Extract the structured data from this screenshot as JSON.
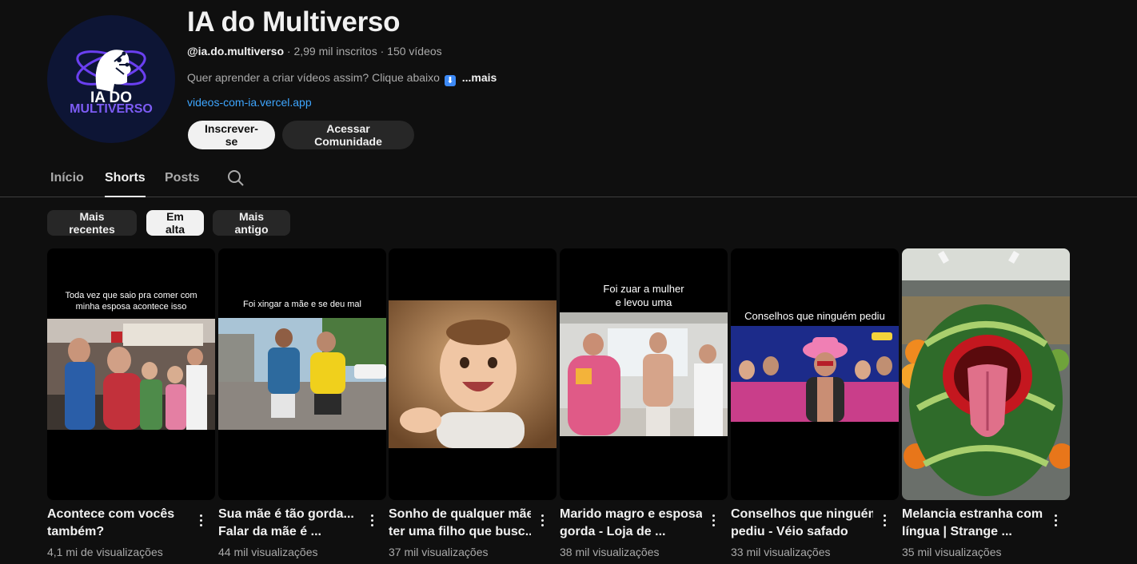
{
  "channel": {
    "logo_line1": "IA DO",
    "logo_line2": "MULTIVERSO",
    "name": "IA do Multiverso",
    "handle": "@ia.do.multiverso",
    "stats": " · 2,99 mil inscritos · 150 vídeos",
    "description": "Quer aprender a criar vídeos assim? Clique abaixo",
    "description_emoji": "⬇",
    "more_label": "...mais",
    "link": "videos-com-ia.vercel.app",
    "subscribe_label": "Inscrever-se",
    "community_label": "Acessar Comunidade"
  },
  "tabs": {
    "home": "Início",
    "shorts": "Shorts",
    "posts": "Posts",
    "active": "shorts"
  },
  "chips": {
    "recent": "Mais recentes",
    "popular": "Em alta",
    "oldest": "Mais antigo",
    "active": "popular"
  },
  "shorts": [
    {
      "caption": "Toda vez que saio pra comer com minha esposa acontece isso",
      "title_line1": "Acontece com vocês",
      "title_line2": "também?",
      "views": "4,1 mi de visualizações"
    },
    {
      "caption": "Foi xingar a mãe e se deu mal",
      "title_line1": "Sua mãe é tão gorda...",
      "title_line2": "Falar da mãe é ...",
      "views": "44 mil visualizações"
    },
    {
      "caption": "",
      "title_line1": "Sonho de qualquer mãe",
      "title_line2": "ter uma filho que busc...",
      "views": "37 mil visualizações"
    },
    {
      "caption": "Foi zuar a mulher e levou uma",
      "title_line1": "Marido magro e esposa",
      "title_line2": "gorda - Loja de ...",
      "views": "38 mil visualizações"
    },
    {
      "caption": "Conselhos que ninguém pediu",
      "title_line1": "Conselhos que ninguém",
      "title_line2": "pediu - Véio safado",
      "views": "33 mil visualizações"
    },
    {
      "caption": "",
      "title_line1": "Melancia estranha com",
      "title_line2": "língua | Strange ...",
      "views": "35 mil visualizações"
    }
  ],
  "colors": {
    "background": "#0f0f0f",
    "link": "#3ea6ff",
    "chip": "#272727",
    "text_secondary": "#aaaaaa"
  }
}
